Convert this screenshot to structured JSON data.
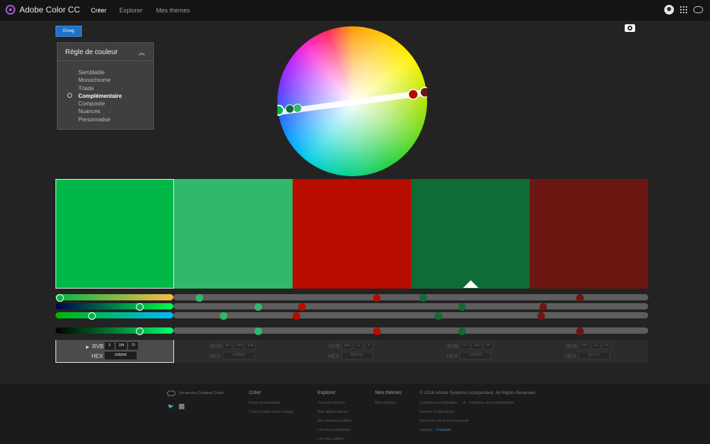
{
  "app": {
    "name": "Adobe Color CC",
    "nav": [
      "Créer",
      "Explorer",
      "Mes thèmes"
    ]
  },
  "toolbar": {
    "save_label": "Enreg"
  },
  "color_rule": {
    "title": "Règle de couleur",
    "options": [
      "Semblable",
      "Monochrome",
      "Triade",
      "Complémentaire",
      "Composite",
      "Nuances",
      "Personnalisé"
    ],
    "selected": "Complémentaire"
  },
  "swatches": [
    {
      "hex": "00B848",
      "rgb": [
        "0",
        "184",
        "75"
      ],
      "color": "#00b848"
    },
    {
      "hex": "31B86B",
      "rgb": [
        "49",
        "184",
        "104"
      ],
      "color": "#31b86b"
    },
    {
      "hex": "B80C00",
      "rgb": [
        "184",
        "12",
        "0"
      ],
      "color": "#b80c00"
    },
    {
      "hex": "106C36",
      "rgb": [
        "16",
        "108",
        "54"
      ],
      "color": "#106c36"
    },
    {
      "hex": "6C1712",
      "rgb": [
        "108",
        "23",
        "18"
      ],
      "color": "#6c1712"
    }
  ],
  "selected_swatch": 0,
  "value_labels": {
    "rgb": "RVB",
    "hex": "HEX"
  },
  "footer": {
    "service": "Un service Creative Cloud",
    "col_create": {
      "title": "Créer",
      "links": [
        "Roue chromatique",
        "Créer à partir d'une image"
      ]
    },
    "col_explore": {
      "title": "Explorer",
      "links": [
        "Tous les thèmes",
        "Mes appréciations",
        "Mes thèmes publiés",
        "Les plus populaires",
        "Les plus utilisés"
      ]
    },
    "col_mythemes": {
      "title": "Mes thèmes",
      "links": [
        "Mes thèmes"
      ]
    },
    "copyright": "© 2016 Adobe Systems Incorporated. All Rights Reserved.",
    "legal": [
      "Conditions d'utilisation",
      "&",
      "Politique de confidentialité"
    ],
    "forum": "Forums d'utilisateurs",
    "guidelines": "Directives de la communauté",
    "language_label": "Langue:",
    "language": "Français"
  }
}
